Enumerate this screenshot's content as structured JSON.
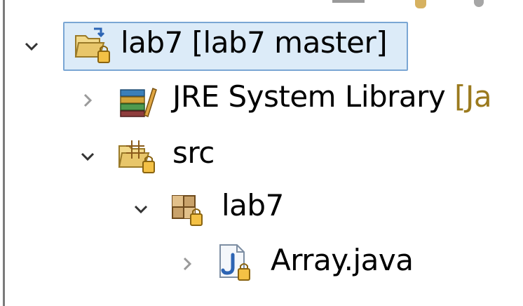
{
  "tree": {
    "items": [
      {
        "name": "lab7",
        "decoration": " [lab7 master]",
        "expanded": true,
        "selected": true,
        "kind": "project-icon"
      },
      {
        "name": "JRE System Library",
        "decoration": " [Ja",
        "expanded": false,
        "kind": "library-icon"
      },
      {
        "name": "src",
        "decoration": "",
        "expanded": true,
        "kind": "source-folder-icon"
      },
      {
        "name": "lab7",
        "decoration": "",
        "expanded": true,
        "kind": "package-icon"
      },
      {
        "name": "Array.java",
        "decoration": "",
        "expanded": false,
        "kind": "java-file-icon"
      }
    ]
  },
  "colors": {
    "selection_bg": "#dcebf8",
    "selection_border": "#7aa6d4",
    "decoration_text": "#9b7a1e",
    "folder": "#e8c66a",
    "java_blue": "#2c64b4"
  }
}
